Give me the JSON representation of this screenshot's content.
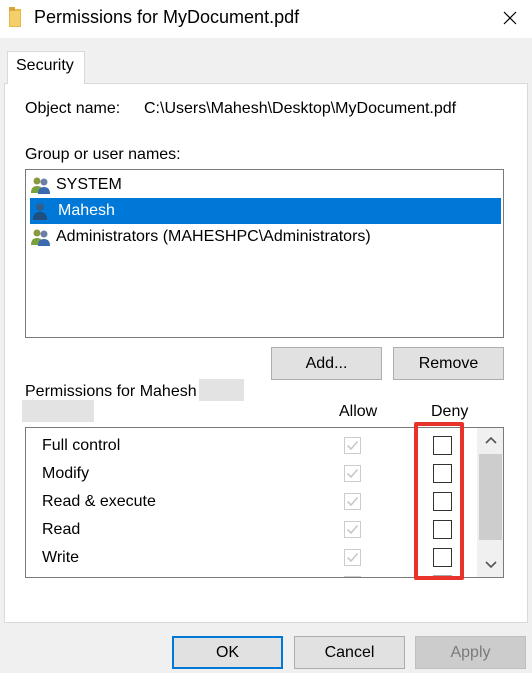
{
  "window": {
    "title": "Permissions for MyDocument.pdf",
    "close_glyph": "✕"
  },
  "tab": {
    "label": "Security"
  },
  "object": {
    "label": "Object name:",
    "value": "C:\\Users\\Mahesh\\Desktop\\MyDocument.pdf"
  },
  "groups": {
    "label": "Group or user names:",
    "items": [
      {
        "name": "SYSTEM",
        "icon": "group-users-icon",
        "selected": false
      },
      {
        "name": "Mahesh",
        "icon": "user-icon",
        "selected": true
      },
      {
        "name": "Administrators (MAHESHPC\\Administrators)",
        "icon": "group-users-icon",
        "selected": false
      }
    ]
  },
  "buttons": {
    "add": "Add...",
    "remove": "Remove",
    "ok": "OK",
    "cancel": "Cancel",
    "apply": "Apply"
  },
  "permissions": {
    "label": "Permissions for Mahesh",
    "allow_header": "Allow",
    "deny_header": "Deny",
    "rows": [
      {
        "name": "Full control",
        "allow": true,
        "deny": false
      },
      {
        "name": "Modify",
        "allow": true,
        "deny": false
      },
      {
        "name": "Read & execute",
        "allow": true,
        "deny": false
      },
      {
        "name": "Read",
        "allow": true,
        "deny": false
      },
      {
        "name": "Write",
        "allow": true,
        "deny": false
      }
    ]
  },
  "colors": {
    "selection": "#0078d7",
    "highlight": "#e8322a",
    "folder": "#e8b84a"
  }
}
